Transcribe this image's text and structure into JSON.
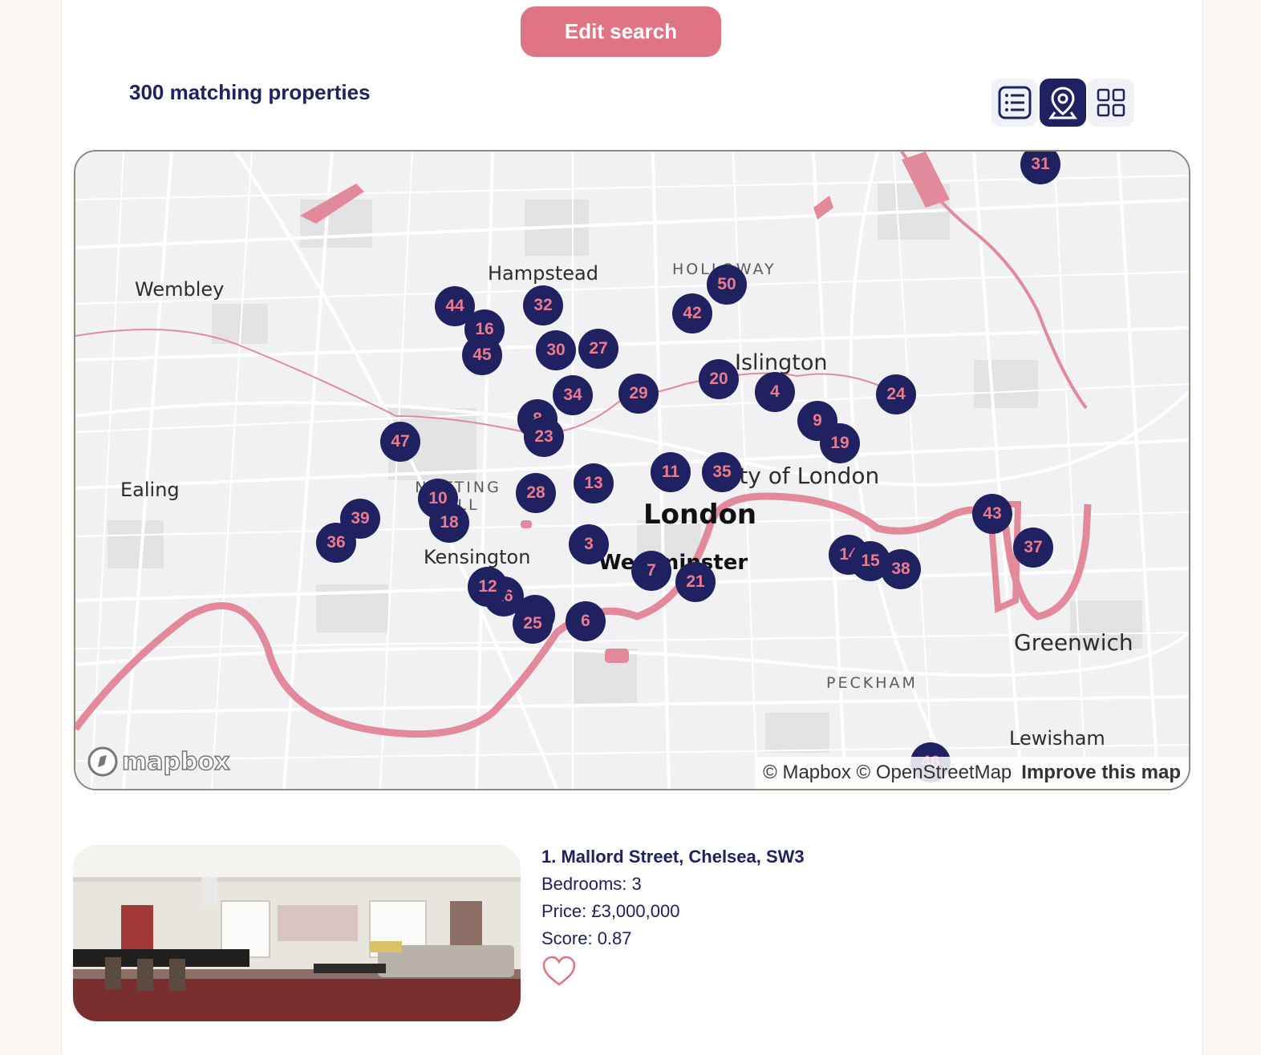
{
  "header": {
    "edit_search_label": "Edit search",
    "result_count": "300 matching properties"
  },
  "view_toggle": {
    "options": [
      "list-view-icon",
      "map-view-icon",
      "grid-view-icon"
    ],
    "active": "map-view-icon"
  },
  "map": {
    "places": [
      "Wembley",
      "Hampstead",
      "HOLLOWAY",
      "Islington",
      "Ealing",
      "NOTTING HILL",
      "London",
      "Kensington",
      "Westminster",
      "City of London",
      "Greenwich",
      "PECKHAM",
      "Lewisham"
    ],
    "markers": [
      "31",
      "50",
      "44",
      "32",
      "42",
      "16",
      "45",
      "30",
      "27",
      "20",
      "4",
      "24",
      "34",
      "29",
      "9",
      "19",
      "8",
      "23",
      "47",
      "11",
      "35",
      "13",
      "28",
      "10",
      "18",
      "39",
      "36",
      "43",
      "37",
      "3",
      "14",
      "15",
      "38",
      "7",
      "21",
      "26",
      "12",
      "5",
      "25",
      "6",
      "46"
    ],
    "logo_text": "mapbox",
    "attribution": "© Mapbox © OpenStreetMap",
    "improve_link": "Improve this map",
    "colors": {
      "land": "#f1f1f3",
      "roads": "#ffffff",
      "water": "#e28a9b",
      "marker": "#1f2160",
      "marker_text": "#e97b8d"
    }
  },
  "listing": {
    "address": "1. Mallord Street, Chelsea, SW3",
    "bedrooms": "Bedrooms: 3",
    "price": "Price: £3,000,000",
    "score": "Score: 0.87",
    "favorite_icon": "heart-icon"
  },
  "colors": {
    "accent": "#df7484",
    "navy": "#1f2160",
    "page_bg": "#fbf7f3"
  }
}
